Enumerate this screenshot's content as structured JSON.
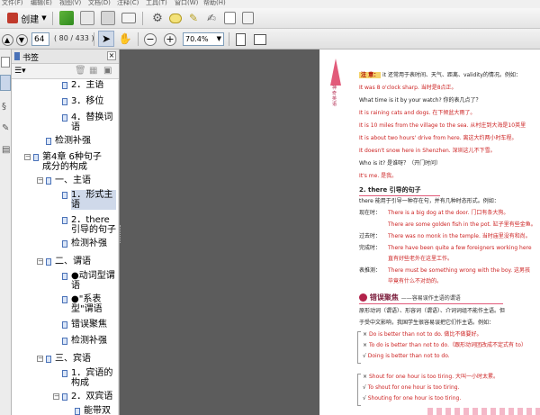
{
  "menubar": {
    "items": [
      "文件(F)",
      "编辑(E)",
      "视图(V)",
      "文档(D)",
      "注释(C)",
      "工具(T)",
      "窗口(W)",
      "帮助(H)"
    ]
  },
  "toolbar": {
    "create_label": "创建",
    "page_number": "64",
    "page_count": "( 80 / 433 )",
    "zoom": "70.4%"
  },
  "sidebar": {
    "title": "书签",
    "items": [
      {
        "label": "2．主语",
        "level": 3
      },
      {
        "label": "3．移位",
        "level": 3
      },
      {
        "label": "4．替换词语",
        "level": 3
      },
      {
        "label": "检测补强",
        "level": 2
      },
      {
        "label": "第4章  6种句子成分的构成",
        "level": 1
      },
      {
        "label": "一、主语",
        "level": 2
      },
      {
        "label": "1．形式主语",
        "level": 3
      },
      {
        "label": "2．there引导的句子",
        "level": 3
      },
      {
        "label": "检测补强",
        "level": 3
      },
      {
        "label": "二、谓语",
        "level": 2
      },
      {
        "label": "●动词型谓语",
        "level": 3
      },
      {
        "label": "●\"系表型\"谓语",
        "level": 3
      },
      {
        "label": "错误聚焦",
        "level": 3
      },
      {
        "label": "检测补强",
        "level": 3
      },
      {
        "label": "三、宾语",
        "level": 2
      },
      {
        "label": "1．宾语的构成",
        "level": 3
      },
      {
        "label": "2．双宾语",
        "level": 3
      },
      {
        "label": "能带双",
        "level": 4
      }
    ]
  },
  "document": {
    "side_label": "神奇英语",
    "note_label": "注 意：",
    "note_text": "it 还常用于表时间、天气、距离、validity的情况。例如：",
    "note_lines": [
      "It was 8 o'clock sharp. 当时是8点正。",
      "What time is it by your watch? 你的表几点了？",
      "It is raining cats and dogs. 在下倾盆大雨了。",
      "It is 10 miles from the village to the sea. 从村庄到大海是10英里",
      "It is about two hours' drive from here. 离这大约两小时车程。",
      "It doesn't snow here in Shenzhen. 深圳这儿不下雪。",
      "Who is it? 是谁呀？（开门时问）",
      "It's me. 是我。"
    ],
    "section_heading": "2. there 引导的句子",
    "section_intro": "there 能用于引导一种存在句，并有几种时态形式。例如：",
    "examples": [
      {
        "tense": "现在时：",
        "text": "There is a big dog at the door. 门口有条大狗。"
      },
      {
        "tense": "",
        "text": "There are some golden fish in the pot. 缸子里有些金鱼。"
      },
      {
        "tense": "过去时：",
        "text": "There was no monk in the temple. 当时庙里没有和尚。"
      },
      {
        "tense": "完成时：",
        "text": "There have been quite a few foreigners working here"
      },
      {
        "tense": "",
        "text": "直有好些老外在这里工作。"
      },
      {
        "tense": "表推测：",
        "text": "There must be something wrong with the boy. 这男孩"
      },
      {
        "tense": "",
        "text": "毕竟有什么不对劲的。"
      }
    ],
    "error_heading": "错误聚焦",
    "error_sub": "——容易误作主语的谓语",
    "error_intro1": "原形动词（谓语）、形容词（谓语）、介词词组不能作主语。但",
    "error_intro2": "于受中文影响，我国学生很容易误把它们作主语。例如：",
    "wrong_right_1": [
      {
        "mark": "×",
        "text": "Do is better than not to do. 做比不做要好。"
      },
      {
        "mark": "×",
        "text": "To do is better than not to do.（跟形动词团改成不定式有 to）"
      },
      {
        "mark": "√",
        "text": "Doing is better than not to do."
      }
    ],
    "wrong_right_2": [
      {
        "mark": "×",
        "text": "Shout for one hour is too tiring. 大叫一小时太累。"
      },
      {
        "mark": "√",
        "text": "To shout for one hour is too tiring."
      },
      {
        "mark": "√",
        "text": "Shouting for one hour is too tiring."
      }
    ]
  },
  "colors": {
    "accent": "#cc2222",
    "note_bg": "#f5d36b",
    "dark": "#5c5c5c"
  }
}
